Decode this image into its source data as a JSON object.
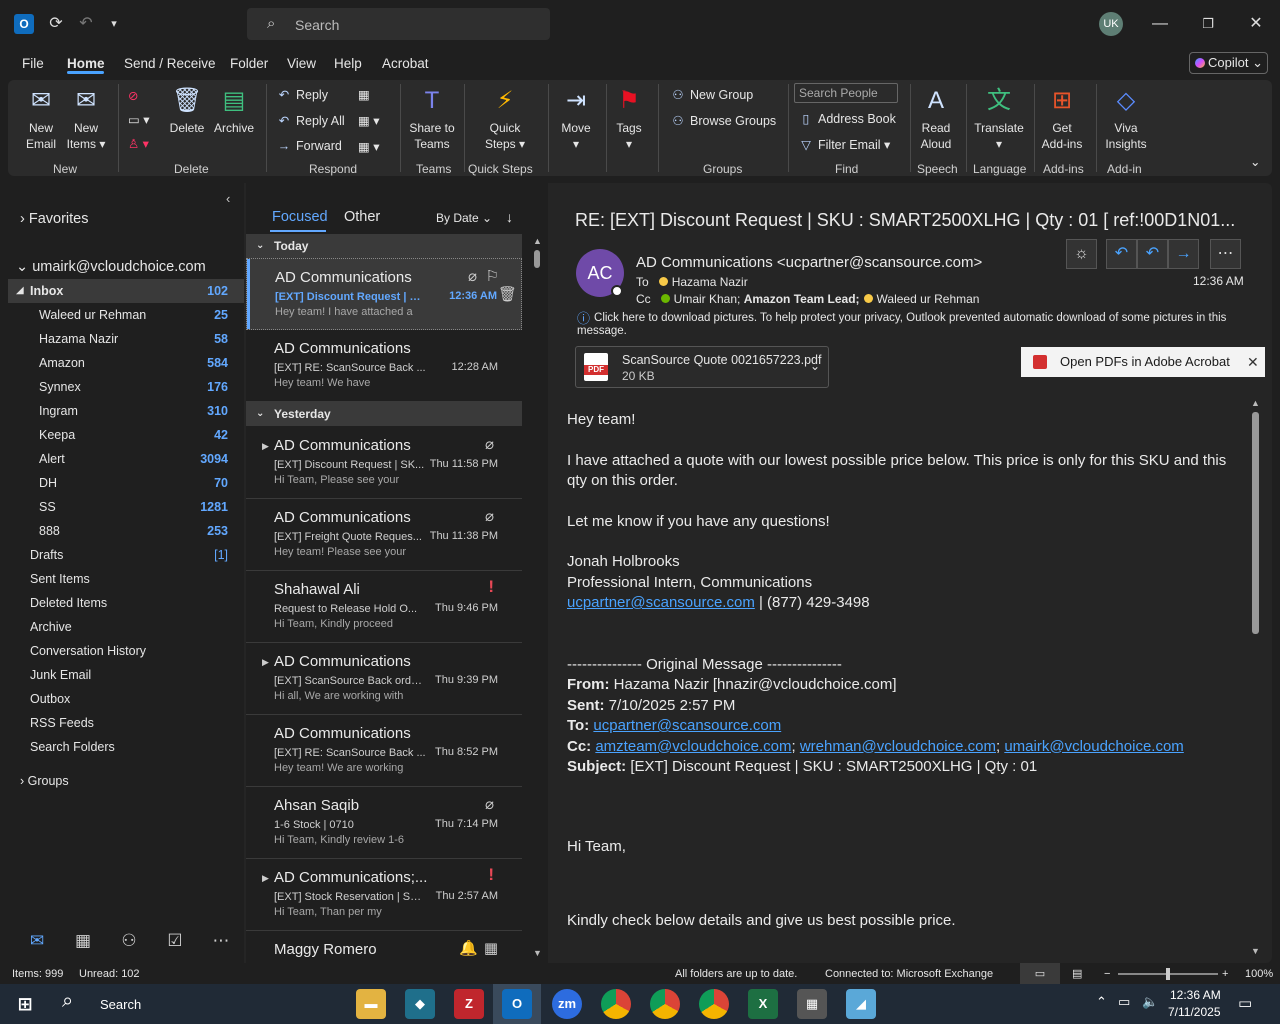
{
  "titlebar": {
    "search_placeholder": "Search",
    "avatar": "UK"
  },
  "menu": [
    "File",
    "Home",
    "Send / Receive",
    "Folder",
    "View",
    "Help",
    "Acrobat"
  ],
  "copilot": "Copilot",
  "ribbon": {
    "new_email": [
      "New",
      "Email"
    ],
    "new_items": [
      "New",
      "Items"
    ],
    "delete": "Delete",
    "archive": "Archive",
    "reply": "Reply",
    "reply_all": "Reply All",
    "forward": "Forward",
    "share_teams": [
      "Share to",
      "Teams"
    ],
    "quick_steps": [
      "Quick",
      "Steps"
    ],
    "move": "Move",
    "tags": "Tags",
    "new_group": "New Group",
    "browse_groups": "Browse Groups",
    "search_people": "Search People",
    "address_book": "Address Book",
    "filter_email": "Filter Email",
    "read_aloud": [
      "Read",
      "Aloud"
    ],
    "translate": "Translate",
    "get_addins": [
      "Get",
      "Add-ins"
    ],
    "viva": [
      "Viva",
      "Insights"
    ],
    "groups": [
      "New",
      "Delete",
      "Respond",
      "Teams",
      "Quick Steps",
      "Groups",
      "Find",
      "Speech",
      "Language",
      "Add-ins",
      "Add-in"
    ]
  },
  "folders": {
    "favorites": "Favorites",
    "account": "umairk@vcloudchoice.com",
    "inbox": {
      "name": "Inbox",
      "count": "102"
    },
    "subfolders": [
      {
        "name": "Waleed ur Rehman",
        "count": "25"
      },
      {
        "name": "Hazama Nazir",
        "count": "58"
      },
      {
        "name": "Amazon",
        "count": "584"
      },
      {
        "name": "Synnex",
        "count": "176"
      },
      {
        "name": "Ingram",
        "count": "310"
      },
      {
        "name": "Keepa",
        "count": "42"
      },
      {
        "name": "Alert",
        "count": "3094"
      },
      {
        "name": "DH",
        "count": "70"
      },
      {
        "name": "SS",
        "count": "1281"
      },
      {
        "name": "888",
        "count": "253"
      }
    ],
    "drafts": {
      "name": "Drafts",
      "count": "[1]"
    },
    "others": [
      "Sent Items",
      "Deleted Items",
      "Archive",
      "Conversation History",
      "Junk Email",
      "Outbox",
      "RSS Feeds",
      "Search Folders"
    ],
    "groups": "Groups"
  },
  "list": {
    "focused": "Focused",
    "other": "Other",
    "sort": "By Date",
    "today": "Today",
    "yesterday": "Yesterday",
    "items": [
      {
        "from": "AD Communications",
        "subject": "[EXT] Discount Request | SK...",
        "time": "12:36 AM",
        "preview": "Hey team!  I have attached a"
      },
      {
        "from": "AD Communications",
        "subject": "[EXT] RE: ScanSource Back ...",
        "time": "12:28 AM",
        "preview": "Hey team!  We have"
      },
      {
        "from": "AD Communications",
        "subject": "[EXT] Discount Request | SK...",
        "time": "Thu 11:58 PM",
        "preview": "Hi Team,  Please see your"
      },
      {
        "from": "AD Communications",
        "subject": "[EXT] Freight Quote Reques...",
        "time": "Thu 11:38 PM",
        "preview": "Hey team!  Please see your"
      },
      {
        "from": "Shahawal Ali",
        "subject": "Request to Release Hold O...",
        "time": "Thu 9:46 PM",
        "preview": "Hi Team,  Kindly proceed"
      },
      {
        "from": "AD Communications",
        "subject": "[EXT] ScanSource Back orde...",
        "time": "Thu 9:39 PM",
        "preview": "Hi all,  We are working with"
      },
      {
        "from": "AD Communications",
        "subject": "[EXT] RE: ScanSource Back ...",
        "time": "Thu 8:52 PM",
        "preview": "Hey team!  We are working"
      },
      {
        "from": "Ahsan Saqib",
        "subject": "1-6 Stock | 0710",
        "time": "Thu 7:14 PM",
        "preview": "Hi Team,  Kindly review 1-6"
      },
      {
        "from": "AD Communications;...",
        "subject": "[EXT] Stock Reservation | SK...",
        "time": "Thu 2:57 AM",
        "preview": "Hi Team,  Than per my"
      },
      {
        "from": "Maggy Romero",
        "subject": "",
        "time": "",
        "preview": ""
      }
    ]
  },
  "reading": {
    "subject": "RE: [EXT] Discount Request | SKU : SMART2500XLHG | Qty : 01     [ ref:!00D1N01...",
    "avatar": "AC",
    "sender": "AD Communications <ucpartner@scansource.com>",
    "to_label": "To",
    "to": "Hazama Nazir",
    "cc_label": "Cc",
    "cc1": "Umair Khan;",
    "cc2": "Amazon Team Lead;",
    "cc3": "Waleed ur Rehman",
    "time": "12:36 AM",
    "info": "Click here to download pictures. To help protect your privacy, Outlook prevented automatic download of some pictures in this message.",
    "attachment_name": "ScanSource Quote 0021657223.pdf",
    "attachment_size": "20 KB",
    "pdf_bar": "Open PDFs in Adobe Acrobat",
    "body": {
      "greet": "Hey team!",
      "p1": "I have attached a quote with our lowest possible price  below. This price is only for this SKU and this qty on this order.",
      "p2": "Let me know if you have any questions!",
      "sig_name": "Jonah Holbrooks",
      "sig_title": "Professional Intern, Communications",
      "sig_email": "ucpartner@scansource.com",
      "sig_phone": " | (877) 429-3498",
      "orig": "--------------- Original Message ---------------",
      "from_label": "From:",
      "from_val": " Hazama Nazir [hnazir@vcloudchoice.com]",
      "sent_label": "Sent:",
      "sent_val": " 7/10/2025 2:57 PM",
      "to_label": "To:",
      "to_val": "ucpartner@scansource.com",
      "cc_label": "Cc:",
      "cc_a": "amzteam@vcloudchoice.com",
      "cc_b": "wrehman@vcloudchoice.com",
      "cc_c": "umairk@vcloudchoice.com",
      "subj_label": "Subject:",
      "subj_val": " [EXT] Discount Request | SKU : SMART2500XLHG | Qty : 01",
      "hi": "Hi Team,",
      "kindly": "Kindly check below details and give us best possible price."
    }
  },
  "status": {
    "items": "Items: 999",
    "unread": "Unread: 102",
    "uptodate": "All folders are up to date.",
    "connected": "Connected to: Microsoft Exchange",
    "zoom": "100%"
  },
  "taskbar": {
    "search": "Search",
    "time": "12:36 AM",
    "date": "7/11/2025"
  }
}
